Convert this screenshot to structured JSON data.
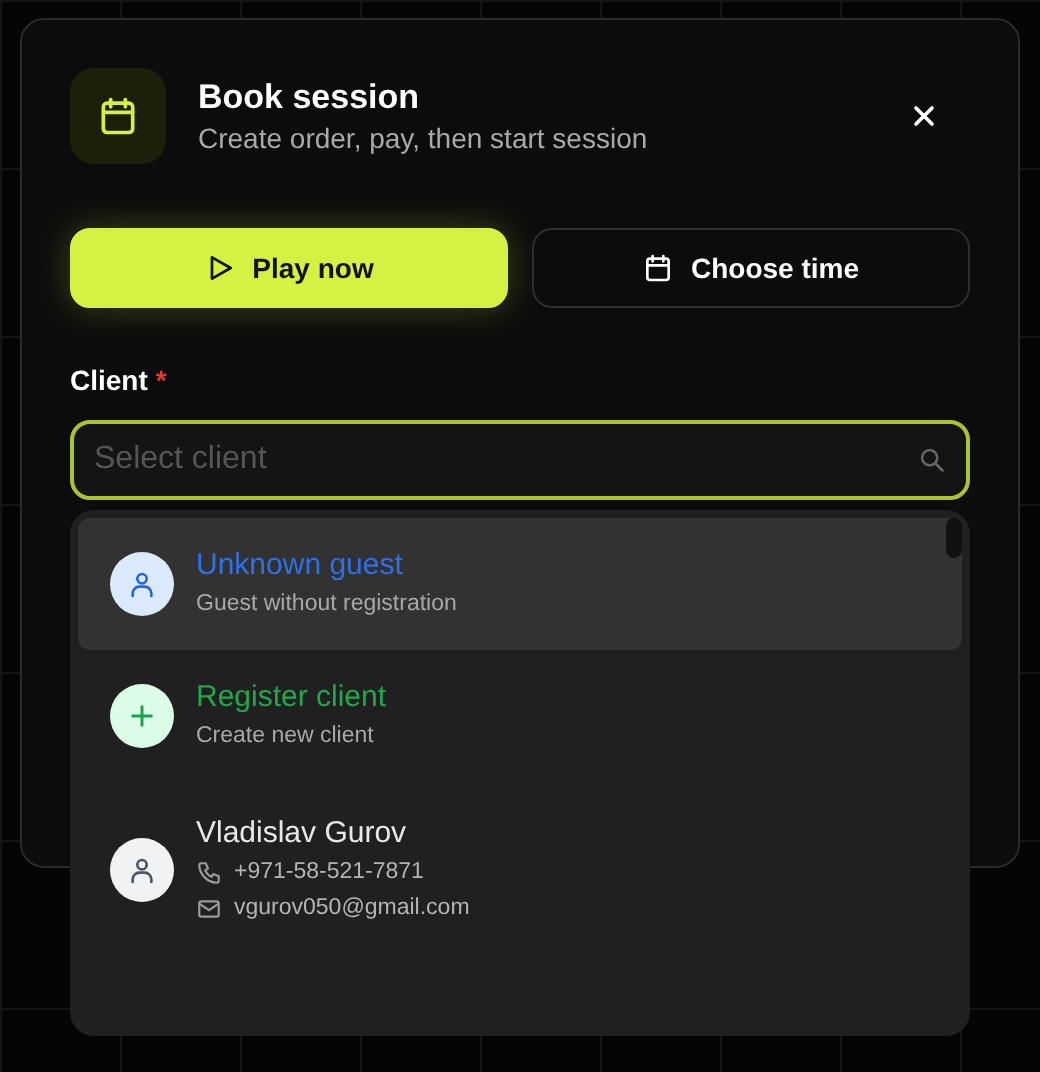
{
  "dialog": {
    "title": "Book session",
    "subtitle": "Create order, pay, then start session"
  },
  "modes": [
    {
      "label": "Play now",
      "kind": "play",
      "selected": true
    },
    {
      "label": "Choose time",
      "kind": "calendar",
      "selected": false
    }
  ],
  "client_field": {
    "label": "Client",
    "required_mark": "*",
    "placeholder": "Select client"
  },
  "client_options": [
    {
      "kind": "guest",
      "name": "Unknown guest",
      "subtitle": "Guest without registration",
      "selected": true
    },
    {
      "kind": "register",
      "name": "Register client",
      "subtitle": "Create new client",
      "selected": false
    },
    {
      "kind": "client",
      "name": "Vladislav Gurov",
      "phone": "+971-58-521-7871",
      "email": "vgurov050@gmail.com",
      "selected": false
    }
  ]
}
